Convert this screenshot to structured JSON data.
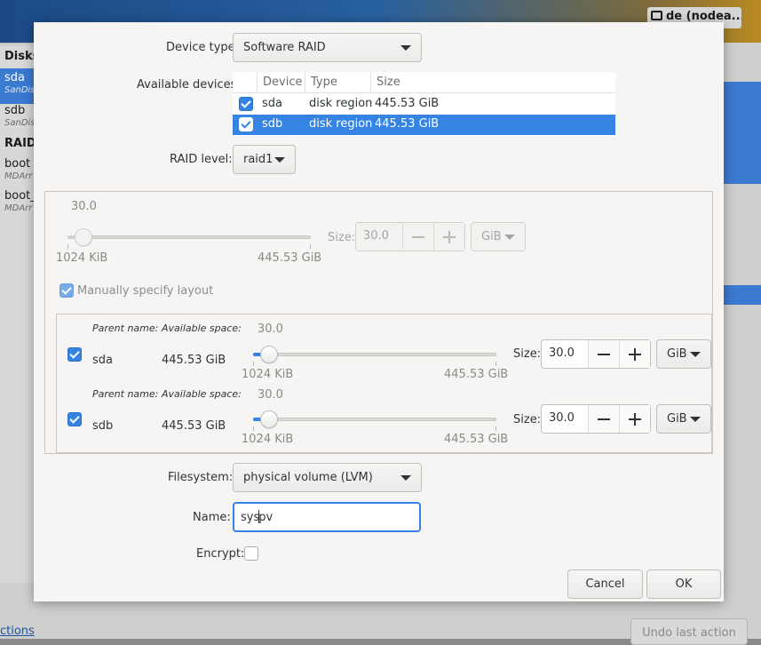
{
  "background": {
    "keyboard_indicator": "de (nodea...",
    "sidebar": {
      "disks_heading": "Disks",
      "items": [
        {
          "label": "sda",
          "sub": "SanDis"
        },
        {
          "label": "sdb",
          "sub": "SanDis"
        }
      ],
      "raid_heading": "RAID",
      "raid_items": [
        {
          "label": "boot",
          "sub": "MDArr"
        },
        {
          "label": "boot_",
          "sub": "MDArr"
        }
      ]
    },
    "bottom_link": "ctions",
    "undo_button": "Undo last action"
  },
  "dialog": {
    "device_type": {
      "label": "Device type:",
      "value": "Software RAID"
    },
    "available_devices": {
      "label": "Available devices:",
      "columns": [
        "Device",
        "Type",
        "Size"
      ],
      "rows": [
        {
          "checked": true,
          "device": "sda",
          "type": "disk region",
          "size": "445.53 GiB",
          "selected": false
        },
        {
          "checked": true,
          "device": "sdb",
          "type": "disk region",
          "size": "445.53 GiB",
          "selected": true
        }
      ]
    },
    "raid_level": {
      "label": "RAID level:",
      "value": "raid1"
    },
    "total_size": {
      "value_label": "30.0",
      "min_label": "1024 KiB",
      "max_label": "445.53 GiB",
      "fraction": 0.067,
      "size_label": "Size:",
      "size_value": "30.0",
      "unit": "GiB",
      "enabled": false
    },
    "manual_layout": {
      "label": "Manually specify layout",
      "checked": true
    },
    "parents": [
      {
        "checked": true,
        "parent_name_header": "Parent name:",
        "available_space_header": "Available space:",
        "name": "sda",
        "available": "445.53 GiB",
        "value_label": "30.0",
        "min_label": "1024 KiB",
        "max_label": "445.53 GiB",
        "fraction": 0.067,
        "size_label": "Size:",
        "size_value": "30.0",
        "unit": "GiB"
      },
      {
        "checked": true,
        "parent_name_header": "Parent name:",
        "available_space_header": "Available space:",
        "name": "sdb",
        "available": "445.53 GiB",
        "value_label": "30.0",
        "min_label": "1024 KiB",
        "max_label": "445.53 GiB",
        "fraction": 0.067,
        "size_label": "Size:",
        "size_value": "30.0",
        "unit": "GiB"
      }
    ],
    "filesystem": {
      "label": "Filesystem:",
      "value": "physical volume (LVM)"
    },
    "name": {
      "label": "Name:",
      "value_before_caret": "sys",
      "value_after_caret": "pv"
    },
    "encrypt": {
      "label": "Encrypt:",
      "checked": false
    },
    "buttons": {
      "cancel": "Cancel",
      "ok": "OK"
    }
  },
  "colors": {
    "accent": "#3584e4",
    "dialog_bg": "#f6f5f4",
    "text": "#2e3436"
  }
}
